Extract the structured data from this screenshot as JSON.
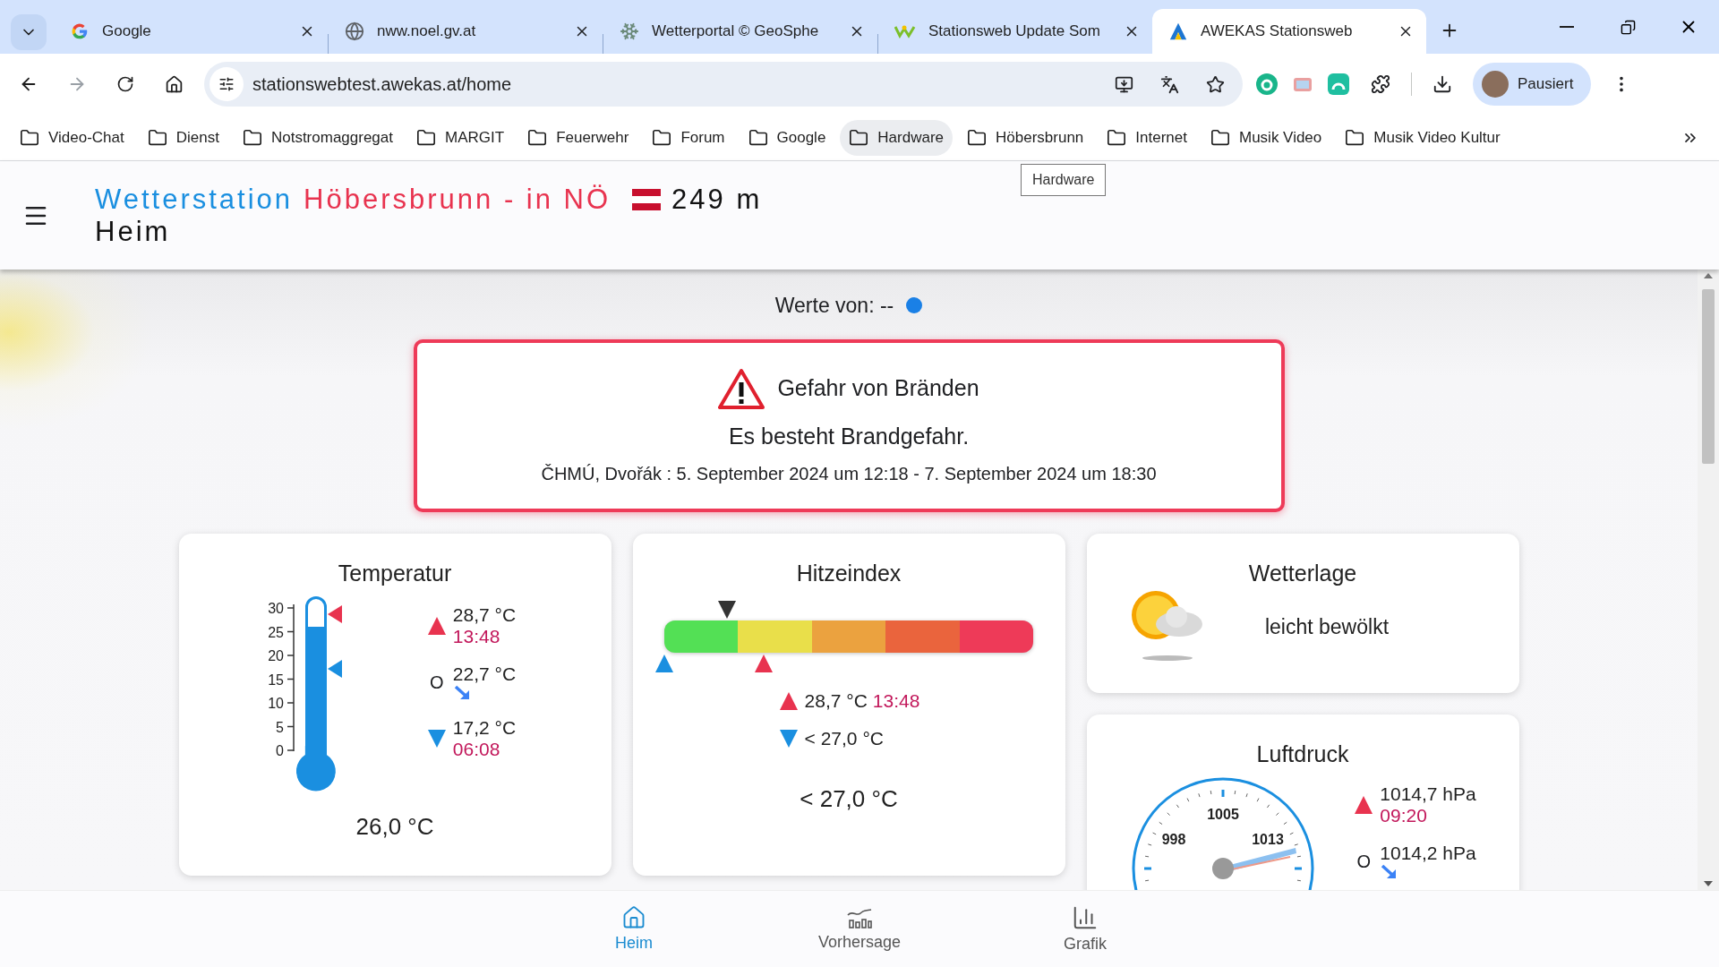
{
  "browser": {
    "tabs": [
      {
        "title": "Google",
        "selected": false
      },
      {
        "title": "nww.noel.gv.at",
        "selected": false
      },
      {
        "title": "Wetterportal © GeoSphe",
        "selected": false
      },
      {
        "title": "Stationsweb Update Som",
        "selected": false
      },
      {
        "title": "AWEKAS Stationsweb",
        "selected": true
      }
    ],
    "address": "stationswebtest.awekas.at/home",
    "profile": "Pausiert",
    "bookmarks": [
      {
        "label": "Video-Chat",
        "highlighted": false
      },
      {
        "label": "Dienst",
        "highlighted": false
      },
      {
        "label": "Notstromaggregat",
        "highlighted": false
      },
      {
        "label": "MARGIT",
        "highlighted": false
      },
      {
        "label": "Feuerwehr",
        "highlighted": false
      },
      {
        "label": "Forum",
        "highlighted": false
      },
      {
        "label": "Google",
        "highlighted": false
      },
      {
        "label": "Hardware",
        "highlighted": true
      },
      {
        "label": "Höbersbrunn",
        "highlighted": false
      },
      {
        "label": "Internet",
        "highlighted": false
      },
      {
        "label": "Musik Video",
        "highlighted": false
      },
      {
        "label": "Musik Video Kultur",
        "highlighted": false
      }
    ],
    "tooltip": "Hardware"
  },
  "header": {
    "title_blue": "Wetterstation",
    "title_red": "Höbersbrunn - in NÖ",
    "elevation": "249 m",
    "subtitle": "Heim"
  },
  "values_from": "Werte von: --",
  "alert": {
    "title": "Gefahr von Bränden",
    "message": "Es besteht Brandgefahr.",
    "source": "ČHMÚ, Dvořák : 5. September 2024 um 12:18 - 7. September 2024 um 18:30"
  },
  "temperature": {
    "title": "Temperatur",
    "scale": [
      "30",
      "25",
      "20",
      "15",
      "10",
      "5",
      "0"
    ],
    "fill": {
      "level": 0.867
    },
    "markers": [
      {
        "kind": "max",
        "level": 0.957
      },
      {
        "kind": "min",
        "level": 0.573
      }
    ],
    "stats": [
      {
        "kind": "max",
        "value": "28,7 °C",
        "time": "13:48"
      },
      {
        "kind": "current",
        "symbol": "O",
        "value": "22,7 °C"
      },
      {
        "kind": "min",
        "value": "17,2 °C",
        "time": "06:08"
      }
    ],
    "current": "26,0 °C"
  },
  "heat_index": {
    "title": "Hitzeindex",
    "segments": [
      {
        "color": "#53e055"
      },
      {
        "color": "#e9df4a"
      },
      {
        "color": "#eba23f"
      },
      {
        "color": "#ea643d"
      },
      {
        "color": "#ee3a58"
      }
    ],
    "pointer": {
      "level": 0.17
    },
    "markers": [
      {
        "kind": "min",
        "level": 0.0
      },
      {
        "kind": "max",
        "level": 0.27
      }
    ],
    "stats": [
      {
        "kind": "max",
        "value": "28,7 °C",
        "time": "13:48"
      },
      {
        "kind": "min",
        "value": "< 27,0 °C"
      }
    ],
    "current": "< 27,0 °C"
  },
  "weather": {
    "title": "Wetterlage",
    "condition": "leicht bewölkt"
  },
  "pressure": {
    "title": "Luftdruck",
    "gauge_labels": [
      "998",
      "1005",
      "1013"
    ],
    "stats": [
      {
        "kind": "max",
        "value": "1014,7 hPa",
        "time": "09:20"
      },
      {
        "kind": "current",
        "symbol": "O",
        "value": "1014,2 hPa"
      }
    ]
  },
  "bottom_nav": [
    {
      "label": "Heim",
      "selected": true
    },
    {
      "label": "Vorhersage",
      "selected": false
    },
    {
      "label": "Grafik",
      "selected": false
    }
  ]
}
